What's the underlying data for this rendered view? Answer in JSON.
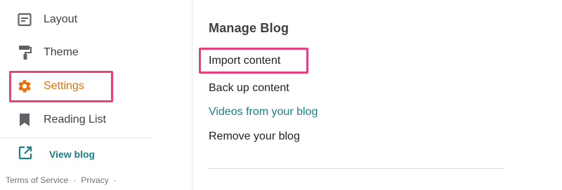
{
  "sidebar": {
    "items": [
      {
        "label": "Layout",
        "icon": "layout-icon"
      },
      {
        "label": "Theme",
        "icon": "paint-roller-icon"
      },
      {
        "label": "Settings",
        "icon": "gear-icon",
        "active": true
      },
      {
        "label": "Reading List",
        "icon": "bookmark-icon"
      }
    ],
    "view_blog": {
      "label": "View blog",
      "icon": "open-in-new-icon"
    },
    "footer": {
      "terms": "Terms of Service",
      "separator_1": "·",
      "privacy": "Privacy",
      "separator_2": "·"
    }
  },
  "main": {
    "title": "Manage Blog",
    "links": [
      {
        "label": "Import content"
      },
      {
        "label": "Back up content"
      },
      {
        "label": "Videos from your blog"
      },
      {
        "label": "Remove your blog"
      }
    ]
  },
  "colors": {
    "accent_orange": "#e8710a",
    "accent_teal": "#1a7f86",
    "highlight_pink": "#e8407a",
    "icon_gray": "#5f6368"
  }
}
